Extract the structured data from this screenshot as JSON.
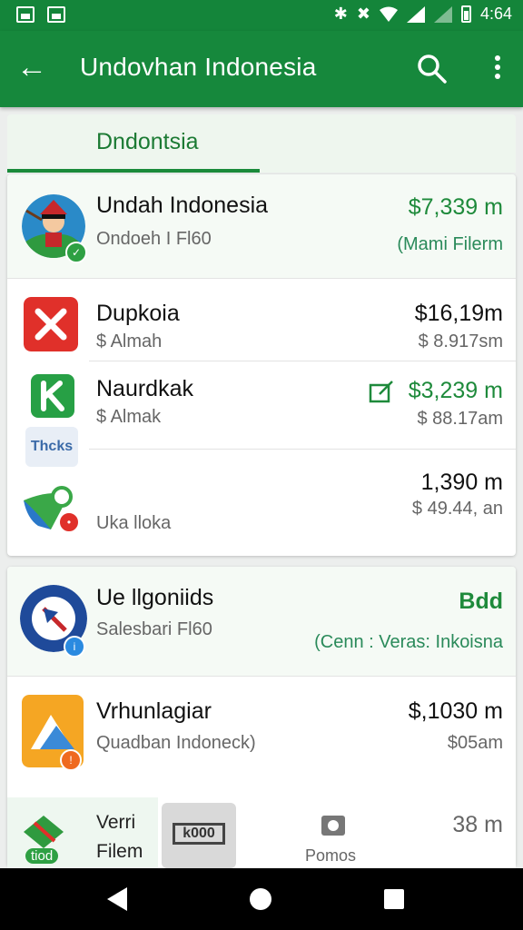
{
  "status_bar": {
    "time": "4:64"
  },
  "app_bar": {
    "title": "Undovhan Indonesia"
  },
  "tabs": [
    {
      "label": "Dndontsia"
    }
  ],
  "list1": [
    {
      "name": "Undah Indonesia",
      "sub": "Ondoeh I Fl60",
      "price": "$7,339 m",
      "amount": "(Mami Filerm",
      "icon": "illustrated-person-icon"
    },
    {
      "name": "Dupkoia",
      "sub": "$ Almah",
      "price": "$16,19m",
      "amount": "$ 8.917sm",
      "icon": "red-x-app-icon"
    },
    {
      "name": "Naurdkak",
      "sub": "$ Almak",
      "price": "$3,239 m",
      "amount": "$ 88.17am",
      "icon": "green-k-app-icon"
    },
    {
      "name": "",
      "sub": "Uka lloka",
      "price": "1,390 m",
      "amount": "$ 49.44, an",
      "icon": "thcks-app-icon"
    }
  ],
  "thcks_label": "Thcks",
  "list2": [
    {
      "name": "Ue llgoniids",
      "sub": "Salesbari Fl60",
      "price": "Bdd",
      "amount": "(Cenn : Veras: Inkoisna",
      "icon": "blue-compass-app-icon"
    },
    {
      "name": "Vrhunlagiar",
      "sub": "Quadban Indoneck)",
      "price": "$,1030 m",
      "amount": "$05am",
      "icon": "orange-mountain-app-icon"
    }
  ],
  "bottom": {
    "item1_label_line1": "Verri",
    "item1_label_line2": "Filem",
    "item1_badge": "tiod",
    "item2_label": "Pomos",
    "item2_code": "k000",
    "amount": "38 m"
  },
  "colors": {
    "primary": "#16883c",
    "accent_green": "#1e8a3b",
    "nav": "#000000"
  }
}
